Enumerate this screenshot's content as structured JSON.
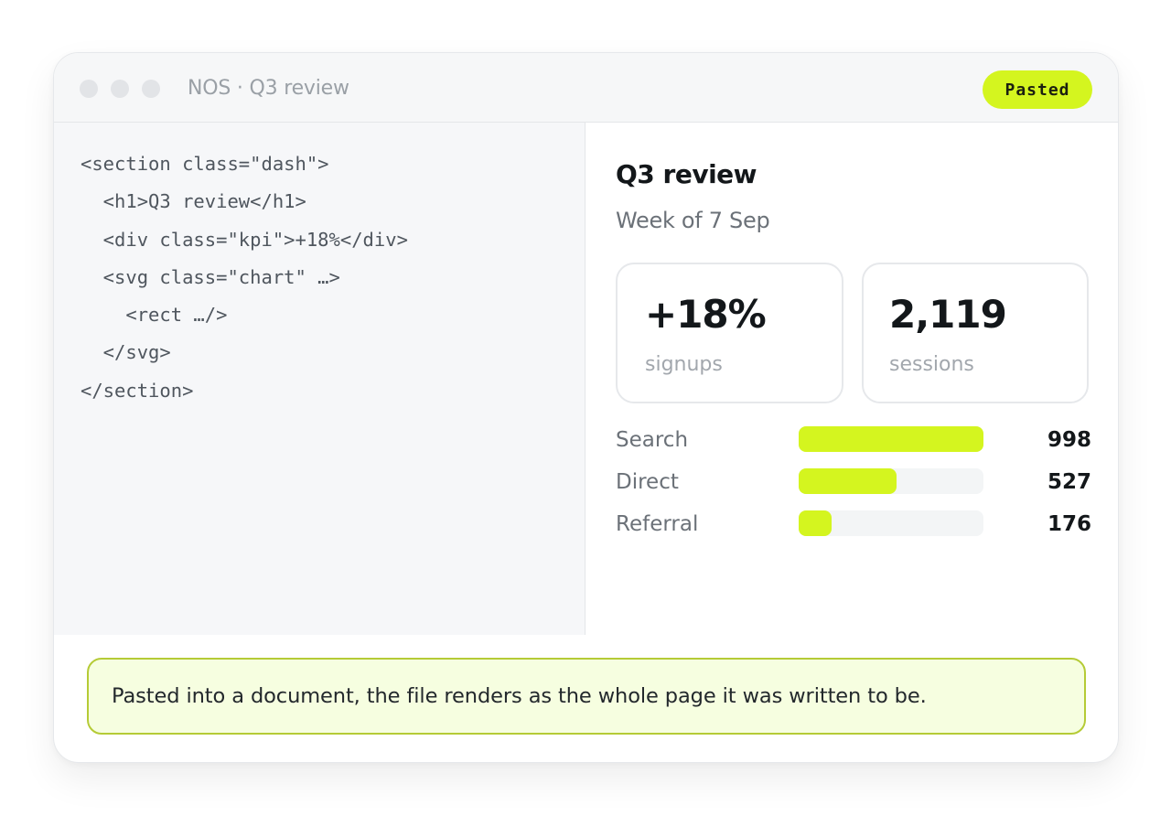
{
  "window": {
    "title": "NOS · Q3 review",
    "badge": "Pasted"
  },
  "code": {
    "lines": [
      "<section class=\"dash\">",
      "  <h1>Q3 review</h1>",
      "  <div class=\"kpi\">+18%</div>",
      "  <svg class=\"chart\" …>",
      "    <rect …/>",
      "  </svg>",
      "</section>"
    ]
  },
  "preview": {
    "title": "Q3 review",
    "subtitle": "Week of 7 Sep",
    "kpis": [
      {
        "value": "+18%",
        "label": "signups"
      },
      {
        "value": "2,119",
        "label": "sessions"
      }
    ],
    "bars": [
      {
        "label": "Search",
        "value": "998",
        "fraction": 1.0
      },
      {
        "label": "Direct",
        "value": "527",
        "fraction": 0.528
      },
      {
        "label": "Referral",
        "value": "176",
        "fraction": 0.176
      }
    ]
  },
  "note": {
    "text": "Pasted into a document, the file renders as the whole page it was written to be."
  },
  "colors": {
    "accent": "#d4f51f",
    "note_bg": "#f6fee0",
    "note_border": "#b5cb36",
    "code_bg": "#f6f7f9"
  }
}
